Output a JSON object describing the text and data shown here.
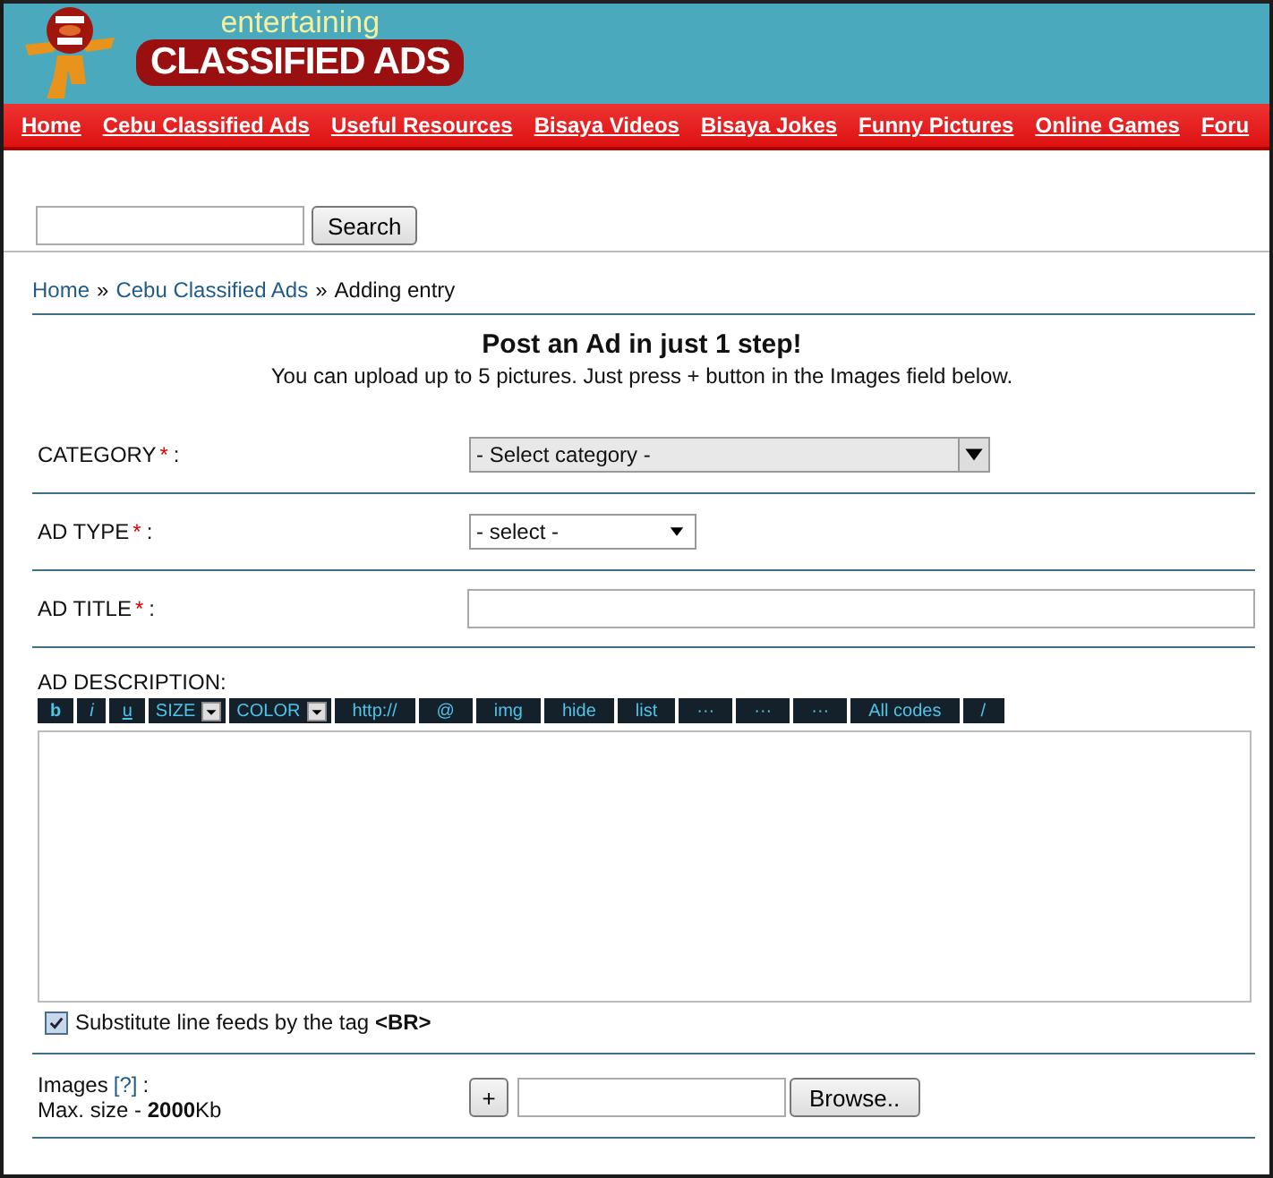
{
  "logo": {
    "tagline": "entertaining",
    "title": "CLASSIFIED ADS"
  },
  "nav": [
    {
      "label": "Home"
    },
    {
      "label": "Cebu Classified Ads"
    },
    {
      "label": "Useful Resources"
    },
    {
      "label": "Bisaya Videos"
    },
    {
      "label": "Bisaya Jokes"
    },
    {
      "label": "Funny Pictures"
    },
    {
      "label": "Online Games"
    },
    {
      "label": "Foru"
    }
  ],
  "search": {
    "button": "Search"
  },
  "breadcrumb": {
    "links": [
      "Home",
      "Cebu Classified Ads"
    ],
    "separator": "»",
    "current": "Adding entry"
  },
  "heading": {
    "title": "Post an Ad in just 1 step!",
    "subtitle": "You can upload up to 5 pictures. Just press + button in the Images field below."
  },
  "fields": [
    {
      "kind": "combo",
      "label": "CATEGORY",
      "mark": "*",
      "suffix": ":",
      "value": "- Select category -"
    },
    {
      "kind": "select",
      "label": "AD TYPE",
      "mark": "*",
      "suffix": ":",
      "value": "- select -"
    },
    {
      "kind": "text",
      "label": "AD TITLE",
      "mark": "*",
      "suffix": ":"
    }
  ],
  "description": {
    "label": "AD DESCRIPTION:",
    "toolbar": [
      {
        "kind": "bold",
        "label": "b"
      },
      {
        "kind": "italic",
        "label": "i"
      },
      {
        "kind": "underline",
        "label": "u"
      },
      {
        "kind": "dropdown",
        "label": "SIZE"
      },
      {
        "kind": "dropdown",
        "label": "COLOR"
      },
      {
        "kind": "button",
        "label": "http://"
      },
      {
        "kind": "button",
        "label": "@"
      },
      {
        "kind": "button",
        "label": "img"
      },
      {
        "kind": "button",
        "label": "hide"
      },
      {
        "kind": "button",
        "label": "list"
      },
      {
        "kind": "button",
        "label": "···"
      },
      {
        "kind": "button",
        "label": "···"
      },
      {
        "kind": "button",
        "label": "···"
      },
      {
        "kind": "button",
        "label": "All codes"
      },
      {
        "kind": "button",
        "label": "/"
      }
    ],
    "checkbox": {
      "label": "Substitute line feeds by the tag **<BR>**",
      "checked": true
    }
  },
  "images": {
    "label": "Images",
    "help": "[?]",
    "suffix": ":",
    "size_note": "Max. size - **2000**Kb",
    "add": "+",
    "browse": "Browse.."
  }
}
